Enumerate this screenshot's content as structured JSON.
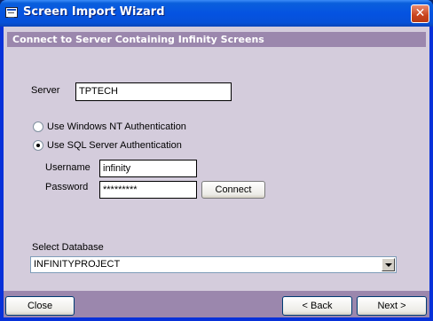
{
  "window": {
    "title": "Screen Import Wizard"
  },
  "header": {
    "title": "Connect to Server Containing Infinity Screens"
  },
  "server": {
    "label": "Server",
    "value": "TPTECH"
  },
  "auth": {
    "option_nt": "Use Windows NT Authentication",
    "option_sql": "Use SQL Server Authentication",
    "selected": "sql"
  },
  "credentials": {
    "username_label": "Username",
    "username_value": "infinity",
    "password_label": "Password",
    "password_value": "*********",
    "connect_label": "Connect"
  },
  "database": {
    "label": "Select Database",
    "selected": "INFINITYPROJECT"
  },
  "footer": {
    "close_label": "Close",
    "back_label": "< Back",
    "next_label": "Next >"
  }
}
